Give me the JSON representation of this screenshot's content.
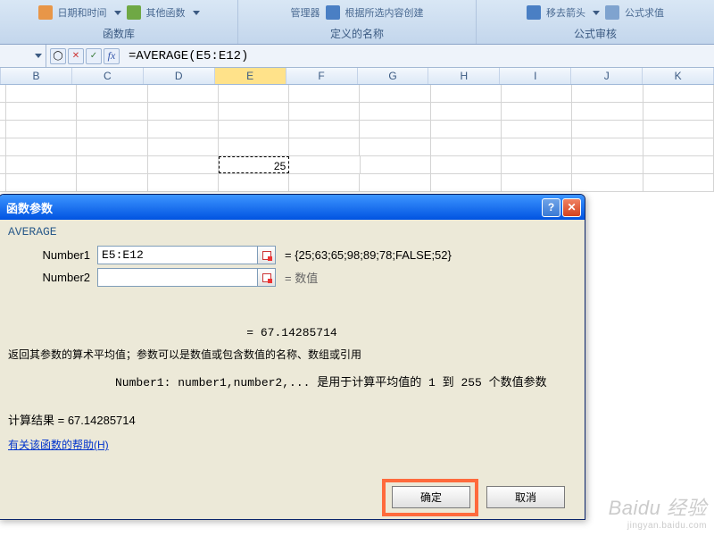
{
  "ribbon": {
    "groups": [
      {
        "items": [
          "日期和时间",
          "其他函数"
        ],
        "label": "函数库"
      },
      {
        "items": [
          "管理器",
          "根据所选内容创建"
        ],
        "label": "定义的名称"
      },
      {
        "items": [
          "移去箭头",
          "公式求值"
        ],
        "label": "公式审核"
      }
    ]
  },
  "formula_bar": {
    "formula": "=AVERAGE(E5:E12)"
  },
  "columns": [
    "B",
    "C",
    "D",
    "E",
    "F",
    "G",
    "H",
    "I",
    "J",
    "K"
  ],
  "active_column": "E",
  "cells": {
    "E_visible": "25"
  },
  "dialog": {
    "title": "函数参数",
    "help_symbol": "?",
    "close_symbol": "✕",
    "function_name": "AVERAGE",
    "args": [
      {
        "label": "Number1",
        "value": "E5:E12",
        "evaluated": "= {25;63;65;98;89;78;FALSE;52}"
      },
      {
        "label": "Number2",
        "value": "",
        "evaluated": "= 数值"
      }
    ],
    "inline_result": "= 67.14285714",
    "description": "返回其参数的算术平均值；参数可以是数值或包含数值的名称、数组或引用",
    "description_sub": "Number1: number1,number2,... 是用于计算平均值的 1 到 255 个数值参数",
    "calc_label": "计算结果 = ",
    "calc_value": "67.14285714",
    "help_link": "有关该函数的帮助(H)",
    "ok": "确定",
    "cancel": "取消"
  },
  "watermark": {
    "brand": "Baidu 经验",
    "sub": "jingyan.baidu.com"
  }
}
